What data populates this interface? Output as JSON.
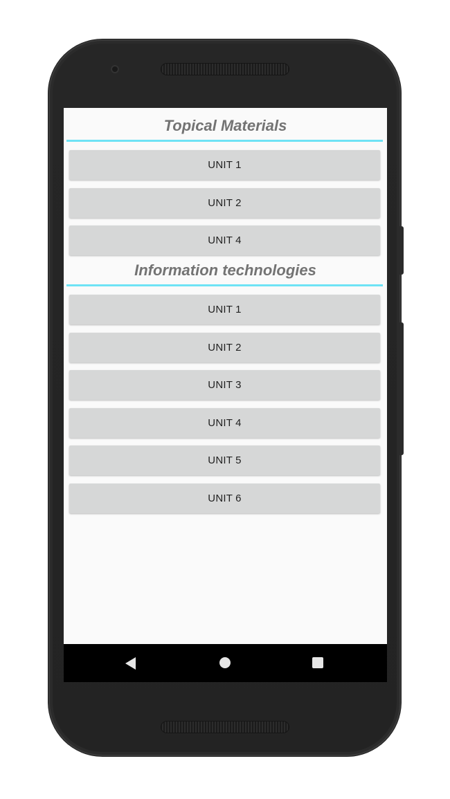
{
  "sections": [
    {
      "title": "Topical Materials",
      "units": [
        "UNIT 1",
        "UNIT 2",
        "UNIT 4"
      ]
    },
    {
      "title": "Information technologies",
      "units": [
        "UNIT 1",
        "UNIT 2",
        "UNIT 3",
        "UNIT 4",
        "UNIT 5",
        "UNIT 6"
      ]
    }
  ],
  "navbar": {
    "back": "back-icon",
    "home": "home-icon",
    "recents": "recents-icon"
  },
  "colors": {
    "accent_divider": "#6ee3f5",
    "button_bg": "#d6d7d7",
    "title_text": "#737373",
    "screen_bg": "#fafafa"
  }
}
